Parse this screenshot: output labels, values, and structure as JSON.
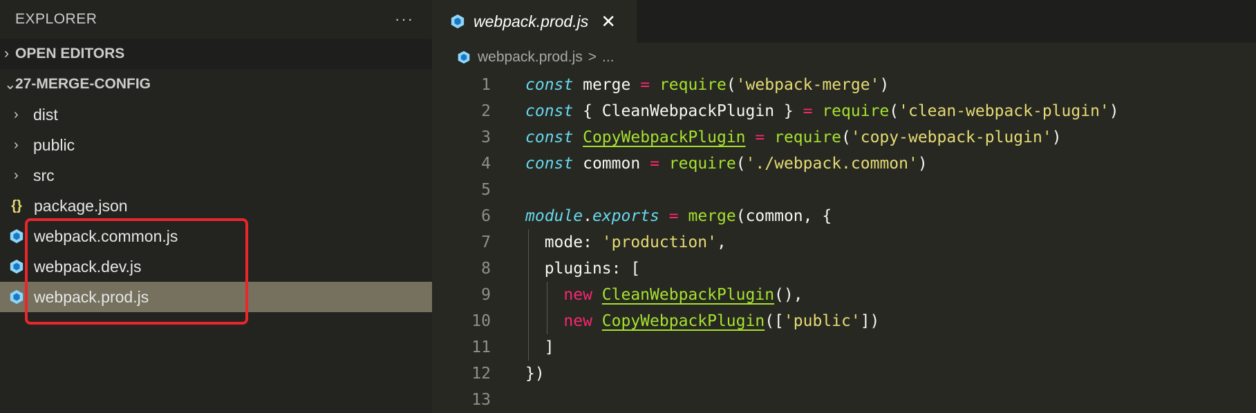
{
  "explorer": {
    "title": "EXPLORER",
    "more_label": "···",
    "sections": {
      "open_editors": "OPEN EDITORS",
      "project": "27-MERGE-CONFIG"
    },
    "folders": [
      "dist",
      "public",
      "src"
    ],
    "files": [
      {
        "name": "package.json",
        "icon": "json-icon"
      },
      {
        "name": "webpack.common.js",
        "icon": "webpack-icon"
      },
      {
        "name": "webpack.dev.js",
        "icon": "webpack-icon"
      },
      {
        "name": "webpack.prod.js",
        "icon": "webpack-icon",
        "selected": true
      }
    ]
  },
  "editor": {
    "tab_title": "webpack.prod.js",
    "close_glyph": "✕",
    "breadcrumb": {
      "file": "webpack.prod.js",
      "sep": ">",
      "more": "..."
    },
    "line_numbers": [
      "1",
      "2",
      "3",
      "4",
      "5",
      "6",
      "7",
      "8",
      "9",
      "10",
      "11",
      "12",
      "13"
    ],
    "code": {
      "const": "const",
      "eq": "=",
      "require": "require",
      "l1_var": "merge",
      "l1_str": "'webpack-merge'",
      "l2_destr": "{ CleanWebpackPlugin }",
      "l2_str": "'clean-webpack-plugin'",
      "l3_var": "CopyWebpackPlugin",
      "l3_str": "'copy-webpack-plugin'",
      "l4_var": "common",
      "l4_str": "'./webpack.common'",
      "l6_module": "module",
      "l6_exports": "exports",
      "l6_merge": "merge",
      "l6_args": "(common, {",
      "l7_key": "mode: ",
      "l7_str": "'production'",
      "l8_key": "plugins: [",
      "new": "new",
      "l9_cls": "CleanWebpackPlugin",
      "l10_cls": "CopyWebpackPlugin",
      "l10_str": "'public'",
      "l11": "]",
      "l12": "})"
    }
  },
  "colors": {
    "sidebar_bg": "#23241f",
    "editor_bg": "#272822",
    "selection": "#75715e",
    "highlight_box": "#e8262c"
  }
}
